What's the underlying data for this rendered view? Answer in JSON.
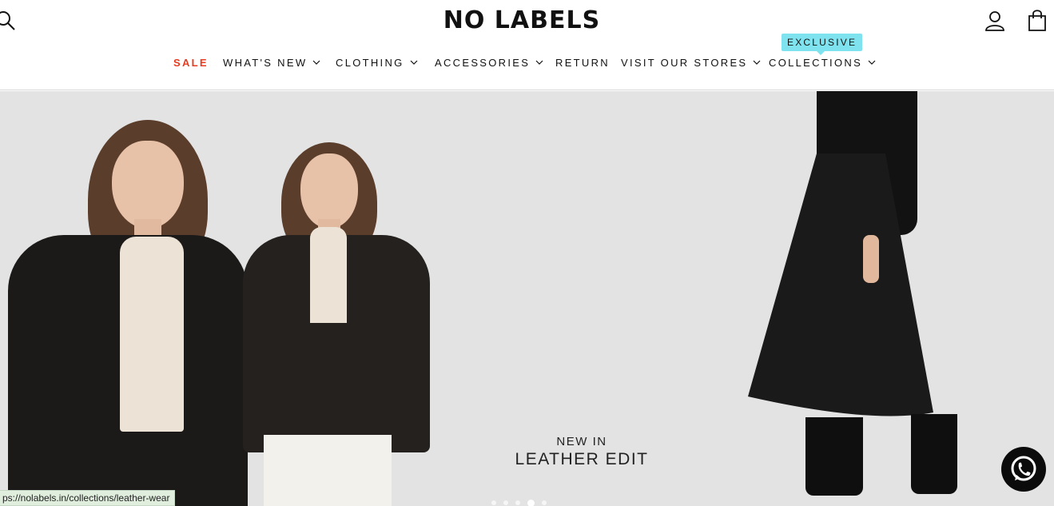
{
  "header": {
    "logo": "NO LABELS",
    "search_icon": "search-icon",
    "account_icon": "user-icon",
    "cart_icon": "cart-icon"
  },
  "nav": {
    "items": [
      {
        "label": "SALE",
        "dropdown": false
      },
      {
        "label": "WHAT'S NEW",
        "dropdown": true
      },
      {
        "label": "CLOTHING",
        "dropdown": true
      },
      {
        "label": "ACCESSORIES",
        "dropdown": true
      },
      {
        "label": "RETURN",
        "dropdown": false
      },
      {
        "label": "VISIT OUR STORES",
        "dropdown": true
      },
      {
        "label": "COLLECTIONS",
        "dropdown": true
      }
    ],
    "badge": "EXCLUSIVE",
    "sale_color": "#e63b1f",
    "badge_color": "#7fe3ef"
  },
  "hero": {
    "caption_small": "NEW IN",
    "caption_large": "LEATHER EDIT",
    "background": "#e3e3e3",
    "slides": 5,
    "active_slide": 4
  },
  "status_bar": {
    "url": "ps://nolabels.in/collections/leather-wear"
  },
  "whatsapp": {
    "icon": "whatsapp-icon"
  }
}
